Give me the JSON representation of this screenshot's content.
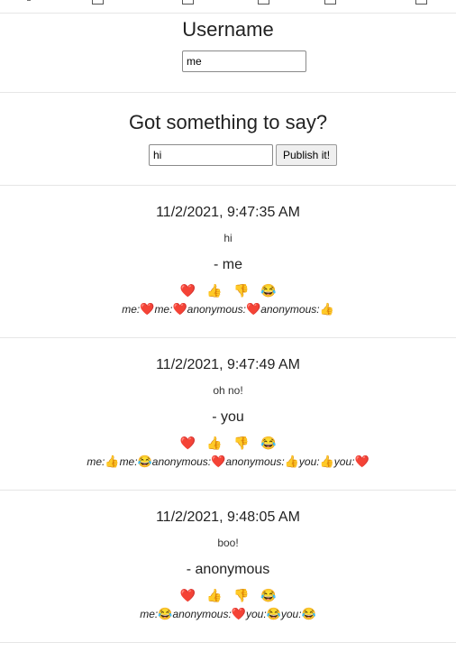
{
  "username_section": {
    "heading": "Username",
    "value": "me"
  },
  "post_section": {
    "heading": "Got something to say?",
    "value": "hi",
    "button_label": "Publish it!"
  },
  "reaction_buttons": [
    {
      "emoji": "❤️",
      "icon": "heart-icon"
    },
    {
      "emoji": "👍",
      "icon": "thumbs-up-icon"
    },
    {
      "emoji": "👎",
      "icon": "thumbs-down-icon"
    },
    {
      "emoji": "😂",
      "icon": "laughing-icon"
    }
  ],
  "messages": [
    {
      "time": "11/2/2021, 9:47:35 AM",
      "text": "hi",
      "author": "- me",
      "reactions": [
        {
          "user": "me:",
          "emoji": "❤️"
        },
        {
          "user": "me:",
          "emoji": "❤️"
        },
        {
          "user": "anonymous:",
          "emoji": "❤️"
        },
        {
          "user": "anonymous:",
          "emoji": "👍"
        }
      ]
    },
    {
      "time": "11/2/2021, 9:47:49 AM",
      "text": "oh no!",
      "author": "- you",
      "reactions": [
        {
          "user": "me:",
          "emoji": "👍"
        },
        {
          "user": "me:",
          "emoji": "😂"
        },
        {
          "user": "anonymous:",
          "emoji": "❤️"
        },
        {
          "user": "anonymous:",
          "emoji": "👍"
        },
        {
          "user": "you:",
          "emoji": "👍"
        },
        {
          "user": "you:",
          "emoji": "❤️"
        }
      ]
    },
    {
      "time": "11/2/2021, 9:48:05 AM",
      "text": "boo!",
      "author": "- anonymous",
      "reactions": [
        {
          "user": "me:",
          "emoji": "😂"
        },
        {
          "user": "anonymous:",
          "emoji": "❤️"
        },
        {
          "user": "you:",
          "emoji": "😂"
        },
        {
          "user": "you:",
          "emoji": "😂"
        }
      ]
    }
  ]
}
